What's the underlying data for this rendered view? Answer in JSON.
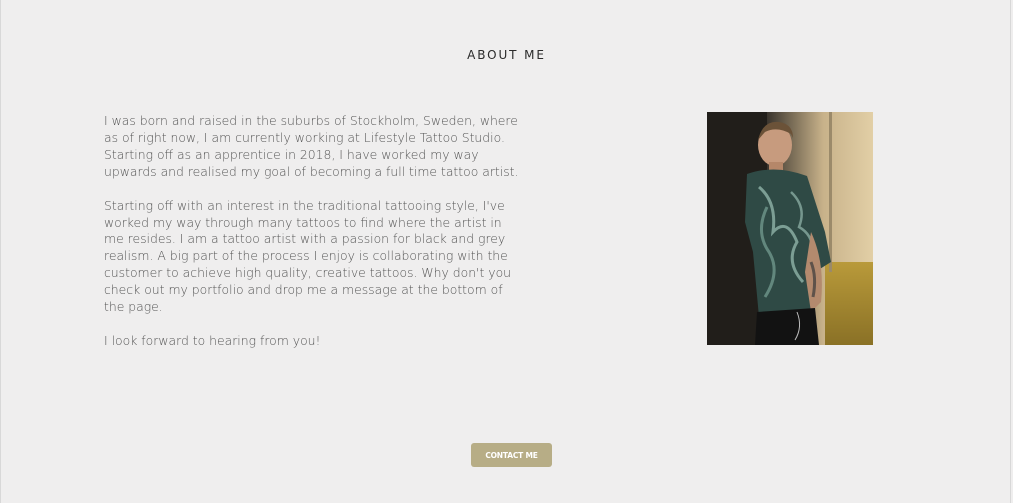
{
  "about": {
    "title": "ABOUT ME",
    "paragraphs": [
      "I was born and raised in the suburbs of Stockholm, Sweden, where as of right now, I am currently working at Lifestyle Tattoo Studio. Starting off as an apprentice in 2018, I have worked my way upwards and realised my goal of becoming a full time tattoo artist.",
      "Starting off with an interest in the traditional tattooing style, I've worked my way through many tattoos to find where the artist in me resides. I am a tattoo artist with a passion for black and grey realism. A big part of the process I enjoy is collaborating with the customer to achieve high quality, creative tattoos. Why don't you check out my portfolio and drop me a message at the bottom of the page.",
      "I look forward to hearing from you!"
    ]
  },
  "contact": {
    "button_label": "CONTACT ME"
  },
  "colors": {
    "background": "#efeeee",
    "button": "#b7ad86",
    "text": "#555555"
  }
}
